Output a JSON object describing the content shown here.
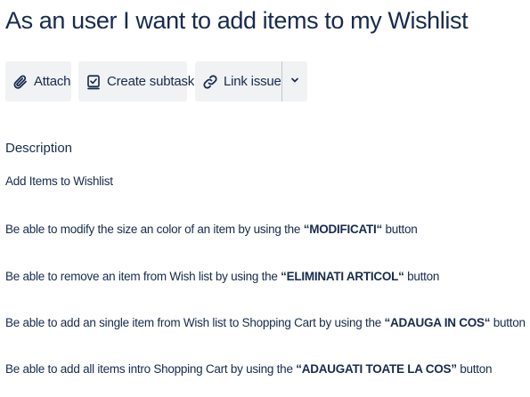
{
  "issue": {
    "title": "As an user I want to add items to my Wishlist"
  },
  "toolbar": {
    "attach_label": "Attach",
    "attach_icon": "paperclip-icon",
    "subtask_label": "Create subtask",
    "subtask_icon": "subtask-checkbox-icon",
    "link_label": "Link issue",
    "link_icon": "link-icon",
    "more_icon": "chevron-down-icon"
  },
  "description": {
    "heading": "Description",
    "summary": "Add Items to Wishlist",
    "lines": [
      {
        "before": "Be able to modify the size an color of an item by using the ",
        "bold": "“MODIFICATI“",
        "after": " button"
      },
      {
        "before": "Be able to remove an item from Wish list by using the ",
        "bold": "“ELIMINATI ARTICOL“",
        "after": " button"
      },
      {
        "before": "Be able to add an single item from Wish list to Shopping Cart by using the ",
        "bold": "“ADAUGA IN COS“",
        "after": " button"
      },
      {
        "before": "Be able to add all items intro Shopping Cart by using the ",
        "bold": "“ADAUGATI TOATE LA COS”",
        "after": " button"
      }
    ]
  },
  "colors": {
    "text": "#172b4d",
    "button_bg": "#f1f2f4",
    "divider": "#c1c7d0"
  }
}
